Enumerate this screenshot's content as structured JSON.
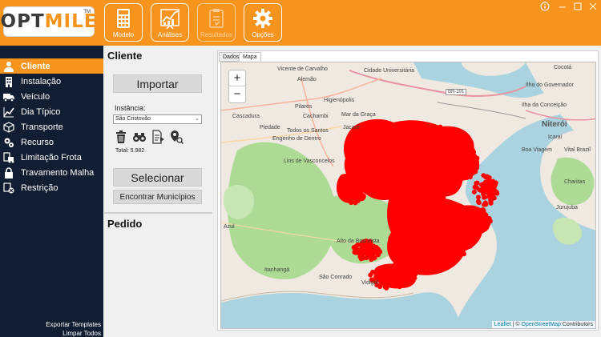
{
  "app": {
    "logo_opt": "OPT",
    "logo_mile": "MILE",
    "logo_tm": "TM",
    "accent": "#f7941d",
    "sidebar_bg": "#111d30"
  },
  "toolbar": {
    "buttons": [
      {
        "label": "Modelo",
        "icon": "calculator-icon",
        "enabled": true
      },
      {
        "label": "Análises",
        "icon": "chart-icon",
        "enabled": true
      },
      {
        "label": "Resultados",
        "icon": "clipboard-icon",
        "enabled": false
      },
      {
        "label": "Opções",
        "icon": "gear-icon",
        "enabled": true
      }
    ]
  },
  "sidebar": {
    "items": [
      {
        "label": "Cliente",
        "icon": "person-icon",
        "active": true
      },
      {
        "label": "Instalação",
        "icon": "building-icon",
        "active": false
      },
      {
        "label": "Veículo",
        "icon": "truck-icon",
        "active": false
      },
      {
        "label": "Dia Típico",
        "icon": "trend-icon",
        "active": false
      },
      {
        "label": "Transporte",
        "icon": "cube-icon",
        "active": false
      },
      {
        "label": "Recurso",
        "icon": "gears-icon",
        "active": false
      },
      {
        "label": "Limitação Frota",
        "icon": "truck-limit-icon",
        "active": false
      },
      {
        "label": "Travamento Malha",
        "icon": "lock-icon",
        "active": false
      },
      {
        "label": "Restrição",
        "icon": "truck-block-icon",
        "active": false
      }
    ],
    "export_templates": "Exportar Templates",
    "clear_all": "Limpar Todos"
  },
  "panel": {
    "title": "Cliente",
    "import_button": "Importar",
    "instance_label": "Instância:",
    "instance_value": "São Cristovão",
    "total": "Total: 5.982",
    "select_button": "Selecionar",
    "find_municipios_button": "Encontrar Municípios",
    "orders_title": "Pedido"
  },
  "map": {
    "tabs": [
      "Dados",
      "Mapa"
    ],
    "active_tab": "Mapa",
    "zoom_in": "+",
    "zoom_out": "−",
    "attribution_leaflet": "Leaflet",
    "attribution_sep": " | © ",
    "attribution_osm": "OpenStreetMap",
    "attribution_contrib": " Contributors",
    "marker_color": "#ff0000",
    "labels": [
      "Vicente de Carvalho",
      "Cidade Universitária",
      "Ilha do Governador",
      "Cocotá",
      "Alemão",
      "Higienópolis",
      "Pilares",
      "Cascadura",
      "Cachambi",
      "Mar da Graça",
      "Piedade",
      "Todos os Santos",
      "Engenho de Dentro",
      "Jacaré",
      "Lins de Vasconcelos",
      "Ilha da Conceição",
      "Niterói",
      "Icaraí",
      "Boa Viagem",
      "Vital Brazil",
      "Charitas",
      "Jurujuba",
      "Itanhangá",
      "São Conrado",
      "Vidigal",
      "Alto da Boa Vista",
      "Azul",
      "BR-101"
    ]
  }
}
